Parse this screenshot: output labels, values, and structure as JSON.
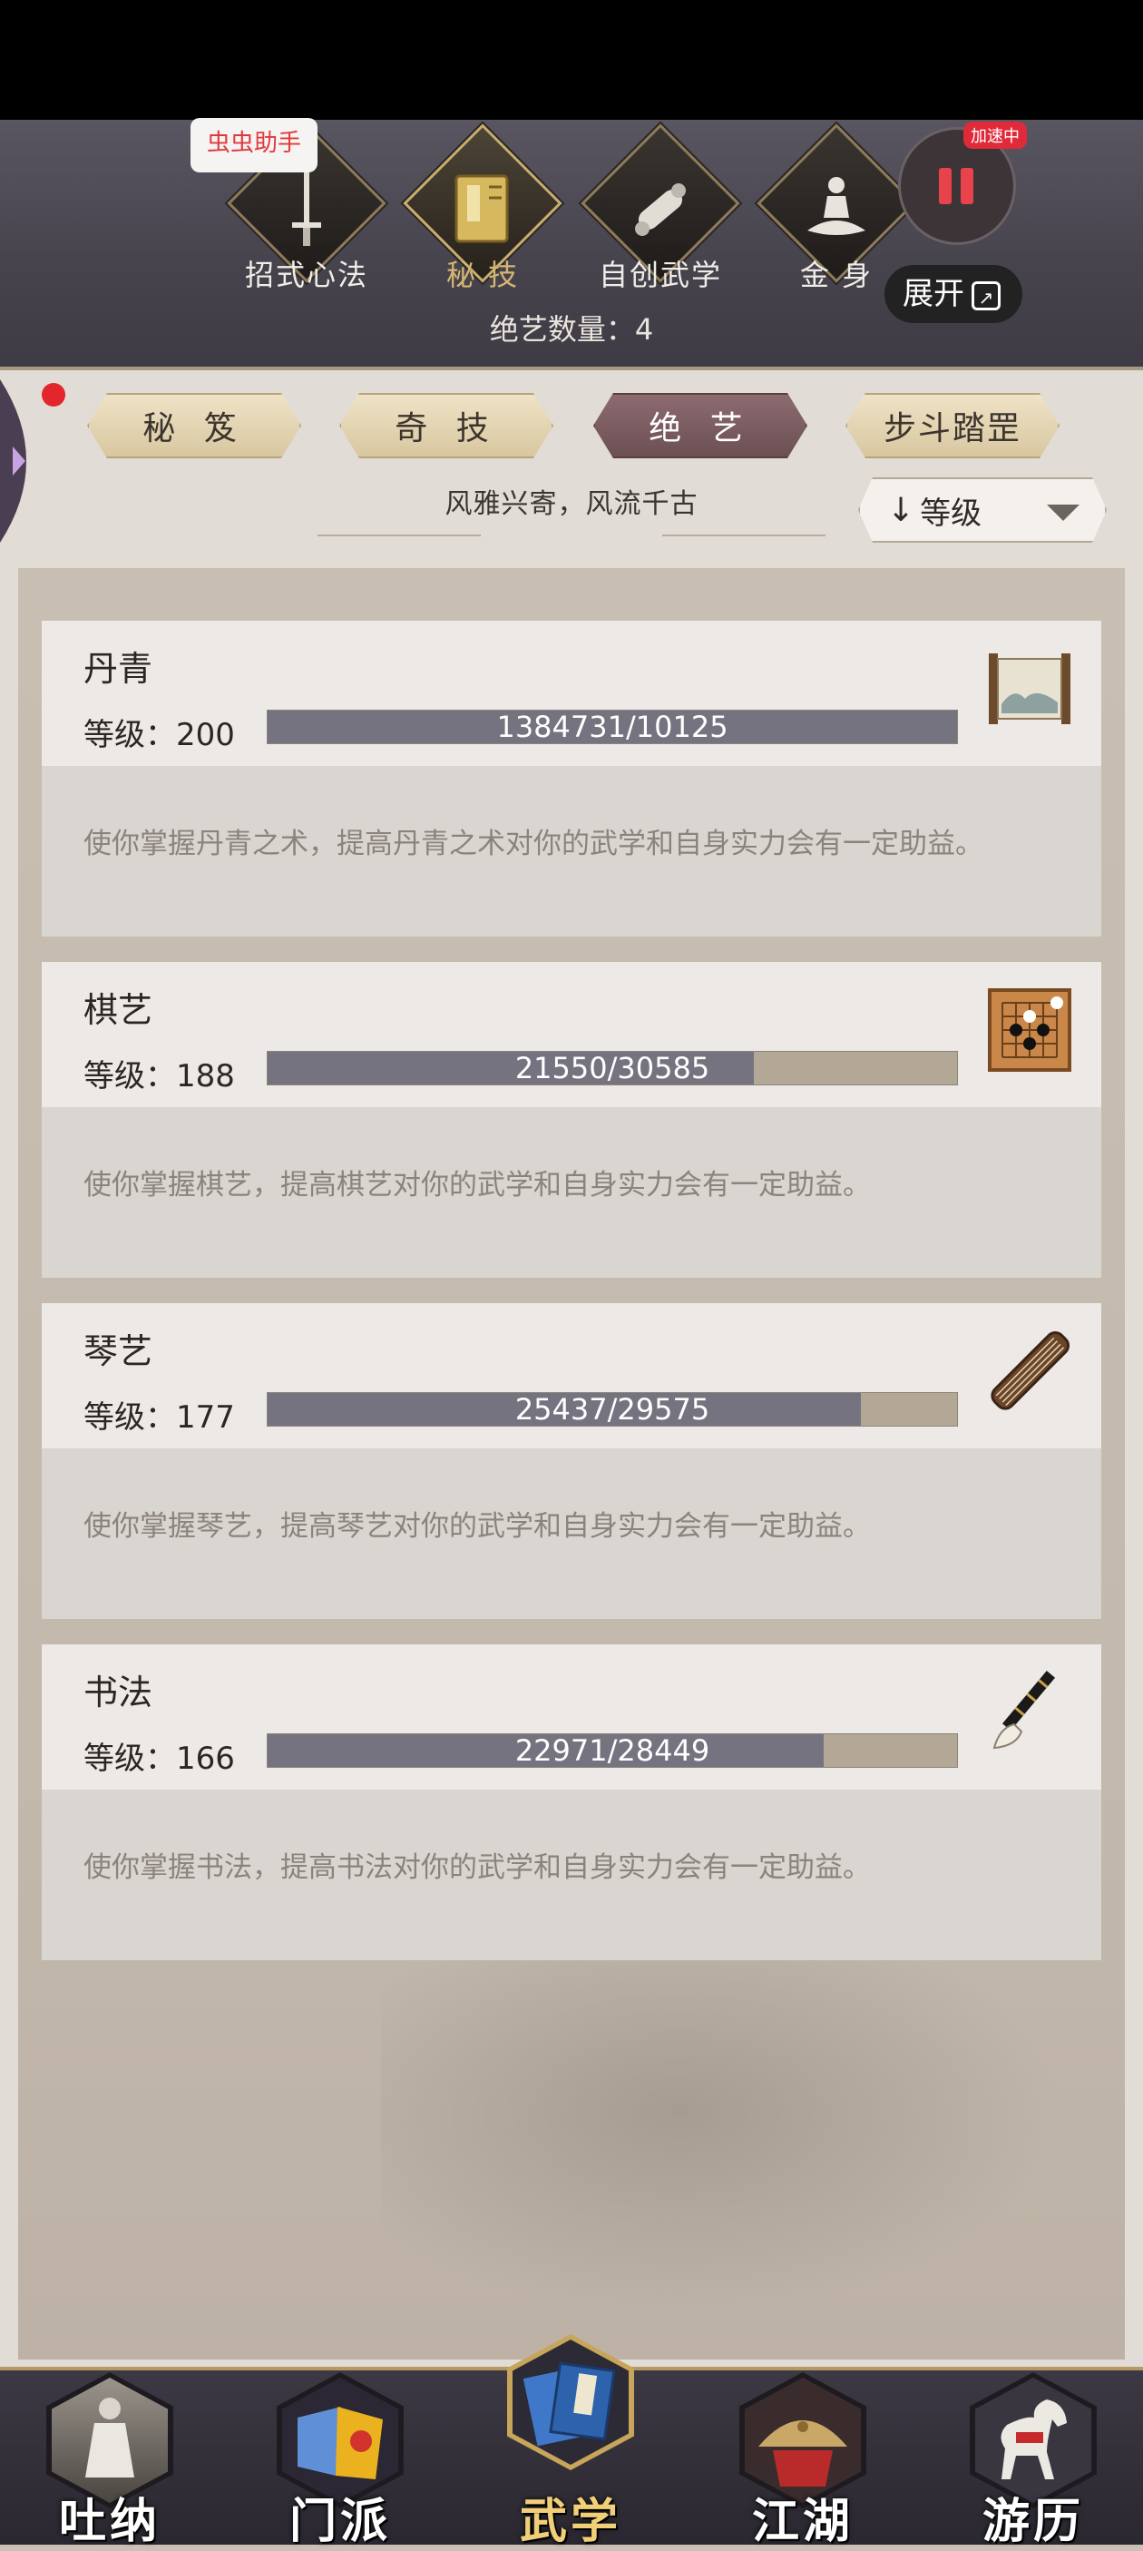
{
  "top_nav": [
    {
      "label": "招式心法",
      "icon": "sword-icon",
      "active": false
    },
    {
      "label": "秘 技",
      "icon": "book-icon",
      "active": true
    },
    {
      "label": "自创武学",
      "icon": "scroll-icon",
      "active": false
    },
    {
      "label": "金 身",
      "icon": "meditation-icon",
      "active": false
    }
  ],
  "overlay": {
    "helper_label": "虫虫助手",
    "speed_badge": "加速中",
    "expand_label": "展开"
  },
  "art_count_label": "绝艺数量：4",
  "sub_tabs": [
    {
      "label": "秘 笈",
      "active": false
    },
    {
      "label": "奇 技",
      "active": false
    },
    {
      "label": "绝 艺",
      "active": true
    },
    {
      "label": "步斗踏罡",
      "active": false
    }
  ],
  "motto": "风雅兴寄，风流千古",
  "sort": {
    "label": "等级",
    "arrow": "↓"
  },
  "skills": [
    {
      "name": "丹青",
      "level_text": "等级：200",
      "progress_text": "1384731/10125",
      "progress": 1.0,
      "icon": "painting-scroll-icon",
      "description": "使你掌握丹青之术，提高丹青之术对你的武学和自身实力会有一定助益。"
    },
    {
      "name": "棋艺",
      "level_text": "等级：188",
      "progress_text": "21550/30585",
      "progress": 0.705,
      "icon": "go-board-icon",
      "description": "使你掌握棋艺，提高棋艺对你的武学和自身实力会有一定助益。"
    },
    {
      "name": "琴艺",
      "level_text": "等级：177",
      "progress_text": "25437/29575",
      "progress": 0.86,
      "icon": "guqin-icon",
      "description": "使你掌握琴艺，提高琴艺对你的武学和自身实力会有一定助益。"
    },
    {
      "name": "书法",
      "level_text": "等级：166",
      "progress_text": "22971/28449",
      "progress": 0.807,
      "icon": "brush-icon",
      "description": "使你掌握书法，提高书法对你的武学和自身实力会有一定助益。"
    }
  ],
  "bottom_nav": [
    {
      "label": "吐纳",
      "icon": "meditating-figure-icon",
      "active": false
    },
    {
      "label": "门派",
      "icon": "sect-banners-icon",
      "active": false
    },
    {
      "label": "武学",
      "icon": "martial-manual-icon",
      "active": true
    },
    {
      "label": "江湖",
      "icon": "straw-hat-icon",
      "active": false
    },
    {
      "label": "游历",
      "icon": "horse-icon",
      "active": false
    }
  ],
  "colors": {
    "progress_fill": "#75737f",
    "progress_track": "#b3a896",
    "active_tab": "#7a5c60",
    "active_gold": "#d4b673"
  }
}
